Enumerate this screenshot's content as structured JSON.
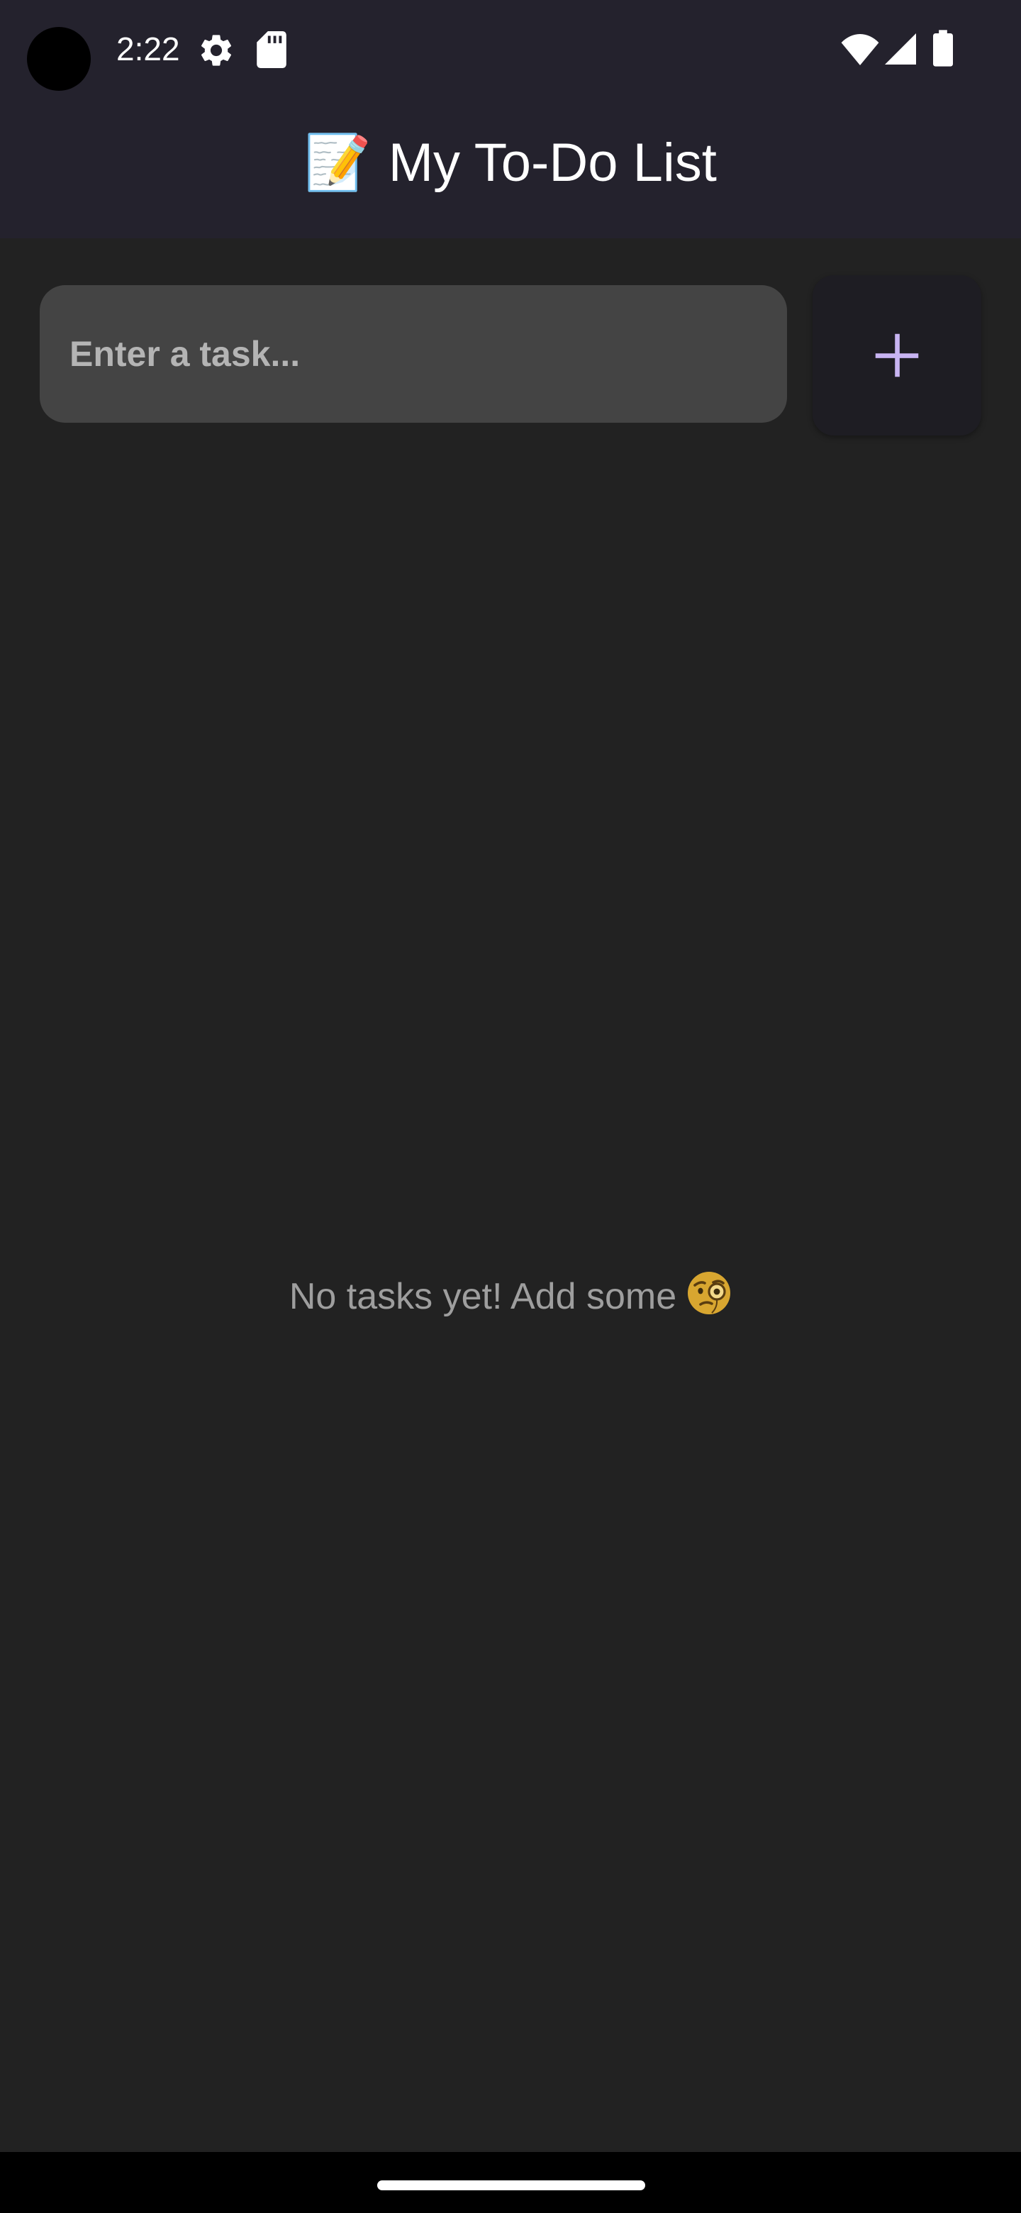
{
  "status_bar": {
    "time": "2:22",
    "icons": [
      "gear-icon",
      "sd-card-icon",
      "wifi-icon",
      "signal-icon",
      "battery-icon"
    ]
  },
  "app_bar": {
    "title_emoji": "📝",
    "title": "My To-Do List",
    "background": "#24222d"
  },
  "task_input": {
    "value": "",
    "placeholder": "Enter a task..."
  },
  "add_button": {
    "icon": "plus-icon",
    "accent": "#c8b4f2"
  },
  "empty_state": {
    "text": "No tasks yet! Add some",
    "icon": "monocle-face-emoji"
  },
  "colors": {
    "background": "#222222",
    "input_fill": "#444444",
    "muted_text": "#9e9e9e"
  }
}
